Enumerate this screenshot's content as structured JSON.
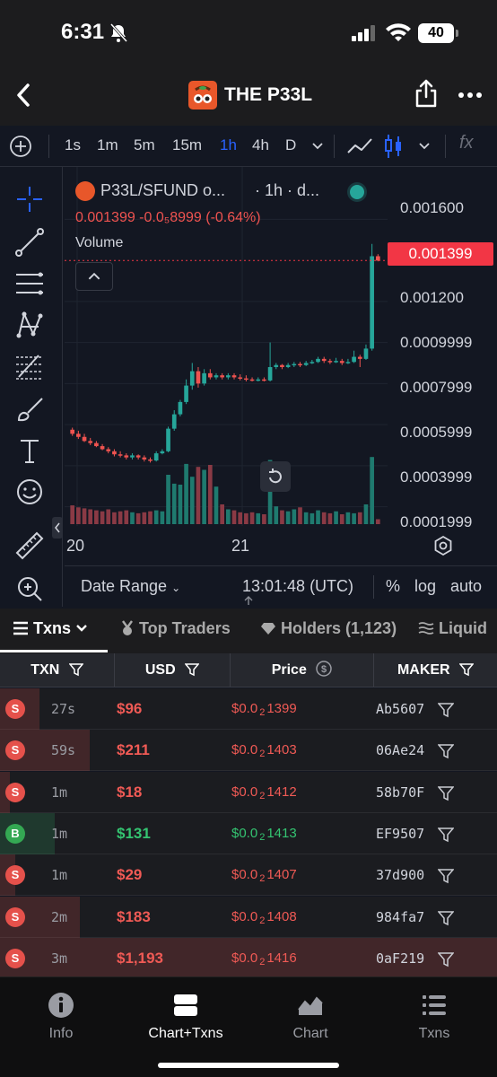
{
  "status_bar": {
    "time": "6:31",
    "battery": "40"
  },
  "header": {
    "title": "THE P33L"
  },
  "toolbar": {
    "timeframes": [
      "1s",
      "1m",
      "5m",
      "15m",
      "1h",
      "4h",
      "D"
    ],
    "active_timeframe": "1h",
    "fx_label": "fx"
  },
  "chart": {
    "symbol": "P33L/SFUND o...",
    "interval": "· 1h · d...",
    "ohlc": "0.001399  -0.0₅8999 (-0.64%)",
    "volume_label": "Volume",
    "last_price": "0.001399",
    "price_axis": [
      "0.001600",
      "0.001200",
      "0.0009999",
      "0.0007999",
      "0.0005999",
      "0.0003999",
      "0.0001999"
    ],
    "date_labels": [
      "20",
      "21"
    ],
    "footer": {
      "date_range": "Date Range",
      "time": "13:01:48 (UTC)",
      "percent": "%",
      "log": "log",
      "auto": "auto"
    },
    "colors": {
      "up": "#26a69a",
      "down": "#ef5350"
    }
  },
  "chart_data": {
    "type": "candlestick",
    "title": "P33L/SFUND",
    "x_labels": [
      "20",
      "21"
    ],
    "ylim": [
      0.00015,
      0.00175
    ],
    "candles": [
      {
        "o": 0.000575,
        "c": 0.000555,
        "h": 0.000585,
        "l": 0.000545
      },
      {
        "o": 0.000555,
        "c": 0.00054,
        "h": 0.00057,
        "l": 0.00053
      },
      {
        "o": 0.00054,
        "c": 0.00052,
        "h": 0.000555,
        "l": 0.000515
      },
      {
        "o": 0.00052,
        "c": 0.00051,
        "h": 0.000535,
        "l": 0.0005
      },
      {
        "o": 0.00051,
        "c": 0.000495,
        "h": 0.00052,
        "l": 0.00049
      },
      {
        "o": 0.000495,
        "c": 0.00048,
        "h": 0.000505,
        "l": 0.000475
      },
      {
        "o": 0.00048,
        "c": 0.00047,
        "h": 0.00049,
        "l": 0.00046
      },
      {
        "o": 0.00047,
        "c": 0.000455,
        "h": 0.00048,
        "l": 0.000445
      },
      {
        "o": 0.000455,
        "c": 0.00045,
        "h": 0.00047,
        "l": 0.00044
      },
      {
        "o": 0.00045,
        "c": 0.00044,
        "h": 0.00046,
        "l": 0.00043
      },
      {
        "o": 0.00044,
        "c": 0.00045,
        "h": 0.00046,
        "l": 0.00043
      },
      {
        "o": 0.00045,
        "c": 0.00044,
        "h": 0.000455,
        "l": 0.00043
      },
      {
        "o": 0.00044,
        "c": 0.00043,
        "h": 0.00045,
        "l": 0.00042
      },
      {
        "o": 0.00043,
        "c": 0.000425,
        "h": 0.00044,
        "l": 0.000415
      },
      {
        "o": 0.000425,
        "c": 0.00046,
        "h": 0.00047,
        "l": 0.00042
      },
      {
        "o": 0.00046,
        "c": 0.00047,
        "h": 0.00048,
        "l": 0.000455
      },
      {
        "o": 0.00047,
        "c": 0.00058,
        "h": 0.00059,
        "l": 0.000465
      },
      {
        "o": 0.00058,
        "c": 0.00065,
        "h": 0.00067,
        "l": 0.00057
      },
      {
        "o": 0.00065,
        "c": 0.00071,
        "h": 0.00072,
        "l": 0.00064
      },
      {
        "o": 0.00071,
        "c": 0.00079,
        "h": 0.00082,
        "l": 0.0007
      },
      {
        "o": 0.00079,
        "c": 0.00086,
        "h": 0.0009,
        "l": 0.00077
      },
      {
        "o": 0.00086,
        "c": 0.0008,
        "h": 0.00088,
        "l": 0.00078
      },
      {
        "o": 0.0008,
        "c": 0.00085,
        "h": 0.00087,
        "l": 0.00079
      },
      {
        "o": 0.00085,
        "c": 0.00083,
        "h": 0.00087,
        "l": 0.00082
      },
      {
        "o": 0.00083,
        "c": 0.00084,
        "h": 0.00085,
        "l": 0.00082
      },
      {
        "o": 0.00084,
        "c": 0.00083,
        "h": 0.00085,
        "l": 0.00082
      },
      {
        "o": 0.00083,
        "c": 0.00084,
        "h": 0.00085,
        "l": 0.00082
      },
      {
        "o": 0.00084,
        "c": 0.00083,
        "h": 0.00085,
        "l": 0.00082
      },
      {
        "o": 0.00083,
        "c": 0.000825,
        "h": 0.000845,
        "l": 0.000815
      },
      {
        "o": 0.000825,
        "c": 0.00082,
        "h": 0.00084,
        "l": 0.00081
      },
      {
        "o": 0.00082,
        "c": 0.000815,
        "h": 0.00083,
        "l": 0.00081
      },
      {
        "o": 0.000815,
        "c": 0.00082,
        "h": 0.00083,
        "l": 0.00081
      },
      {
        "o": 0.00082,
        "c": 0.000815,
        "h": 0.00083,
        "l": 0.00081
      },
      {
        "o": 0.000815,
        "c": 0.00088,
        "h": 0.001,
        "l": 0.00081
      },
      {
        "o": 0.00088,
        "c": 0.00089,
        "h": 0.0009,
        "l": 0.00087
      },
      {
        "o": 0.00089,
        "c": 0.00088,
        "h": 0.000895,
        "l": 0.00087
      },
      {
        "o": 0.00088,
        "c": 0.00089,
        "h": 0.0009,
        "l": 0.000875
      },
      {
        "o": 0.00089,
        "c": 0.000895,
        "h": 0.000905,
        "l": 0.00088
      },
      {
        "o": 0.000895,
        "c": 0.00089,
        "h": 0.000905,
        "l": 0.00088
      },
      {
        "o": 0.00089,
        "c": 0.0009,
        "h": 0.00091,
        "l": 0.000885
      },
      {
        "o": 0.0009,
        "c": 0.000905,
        "h": 0.000915,
        "l": 0.000895
      },
      {
        "o": 0.000905,
        "c": 0.00092,
        "h": 0.00093,
        "l": 0.0009
      },
      {
        "o": 0.00092,
        "c": 0.00091,
        "h": 0.00093,
        "l": 0.0009
      },
      {
        "o": 0.00091,
        "c": 0.000905,
        "h": 0.00092,
        "l": 0.000895
      },
      {
        "o": 0.000905,
        "c": 0.00091,
        "h": 0.000925,
        "l": 0.0009
      },
      {
        "o": 0.00091,
        "c": 0.0009,
        "h": 0.00092,
        "l": 0.00089
      },
      {
        "o": 0.0009,
        "c": 0.000905,
        "h": 0.00092,
        "l": 0.000895
      },
      {
        "o": 0.000905,
        "c": 0.00093,
        "h": 0.00096,
        "l": 0.0009
      },
      {
        "o": 0.00093,
        "c": 0.00092,
        "h": 0.00094,
        "l": 0.00088
      },
      {
        "o": 0.00092,
        "c": 0.00097,
        "h": 0.00099,
        "l": 0.000915
      },
      {
        "o": 0.00097,
        "c": 0.00142,
        "h": 0.00148,
        "l": 0.00096
      },
      {
        "o": 0.00142,
        "c": 0.001399,
        "h": 0.00143,
        "l": 0.001395
      }
    ],
    "volumes": [
      0.19,
      0.17,
      0.16,
      0.15,
      0.14,
      0.13,
      0.15,
      0.12,
      0.13,
      0.14,
      0.12,
      0.11,
      0.12,
      0.13,
      0.14,
      0.13,
      0.5,
      0.41,
      0.4,
      0.61,
      0.48,
      0.58,
      0.55,
      0.6,
      0.38,
      0.2,
      0.15,
      0.14,
      0.12,
      0.11,
      0.12,
      0.11,
      0.1,
      0.65,
      0.18,
      0.14,
      0.13,
      0.15,
      0.17,
      0.12,
      0.11,
      0.14,
      0.12,
      0.11,
      0.13,
      0.1,
      0.12,
      0.11,
      0.12,
      0.2,
      0.68,
      0.05
    ],
    "last_price": 0.001399
  },
  "tabs": [
    {
      "label": "Txns",
      "icon": "list-icon"
    },
    {
      "label": "Top Traders",
      "icon": "medal-icon"
    },
    {
      "label": "Holders (1,123)",
      "icon": "diamond-icon"
    },
    {
      "label": "Liquid",
      "icon": "lines-icon"
    }
  ],
  "table": {
    "headers": [
      "TXN",
      "USD",
      "Price",
      "MAKER"
    ],
    "rows": [
      {
        "type": "S",
        "age": "27s",
        "usd": "$96",
        "price_prefix": "$0.0",
        "price_sub": "2",
        "price_rest": "1399",
        "maker": "Ab5607",
        "bar": 0.08
      },
      {
        "type": "S",
        "age": "59s",
        "usd": "$211",
        "price_prefix": "$0.0",
        "price_sub": "2",
        "price_rest": "1403",
        "maker": "06Ae24",
        "bar": 0.18
      },
      {
        "type": "S",
        "age": "1m",
        "usd": "$18",
        "price_prefix": "$0.0",
        "price_sub": "2",
        "price_rest": "1412",
        "maker": "58b70F",
        "bar": 0.02
      },
      {
        "type": "B",
        "age": "1m",
        "usd": "$131",
        "price_prefix": "$0.0",
        "price_sub": "2",
        "price_rest": "1413",
        "maker": "EF9507",
        "bar": 0.11
      },
      {
        "type": "S",
        "age": "1m",
        "usd": "$29",
        "price_prefix": "$0.0",
        "price_sub": "2",
        "price_rest": "1407",
        "maker": "37d900",
        "bar": 0.03
      },
      {
        "type": "S",
        "age": "2m",
        "usd": "$183",
        "price_prefix": "$0.0",
        "price_sub": "2",
        "price_rest": "1408",
        "maker": "984fa7",
        "bar": 0.16
      },
      {
        "type": "S",
        "age": "3m",
        "usd": "$1,193",
        "price_prefix": "$0.0",
        "price_sub": "2",
        "price_rest": "1416",
        "maker": "0aF219",
        "bar": 1.0
      }
    ]
  },
  "bottom_nav": [
    {
      "label": "Info",
      "icon": "info-icon"
    },
    {
      "label": "Chart+Txns",
      "icon": "split-icon",
      "active": true
    },
    {
      "label": "Chart",
      "icon": "area-chart-icon"
    },
    {
      "label": "Txns",
      "icon": "list-icon"
    }
  ]
}
